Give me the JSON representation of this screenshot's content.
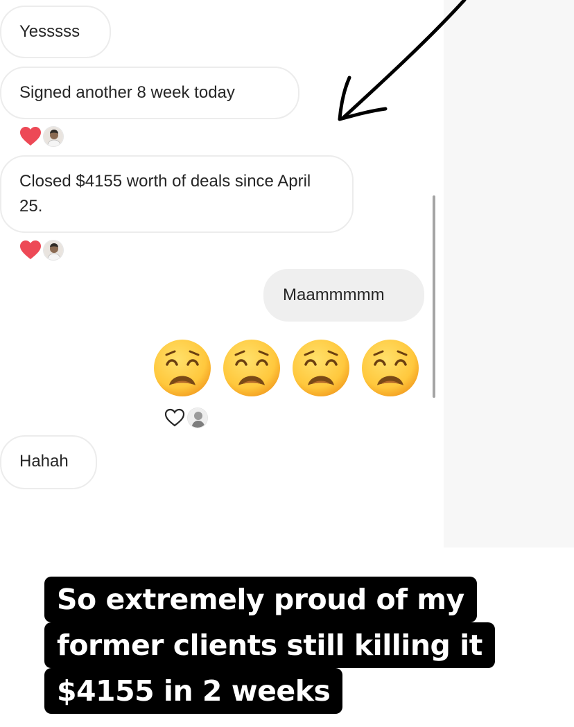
{
  "messages": [
    {
      "text": "Yesssss",
      "direction": "incoming"
    },
    {
      "text": "Signed another 8 week today",
      "direction": "incoming"
    },
    {
      "text": "Closed $4155 worth of deals since April 25.",
      "direction": "incoming"
    },
    {
      "text": "Maammmmm",
      "direction": "outgoing"
    },
    {
      "text": "Hahah",
      "direction": "incoming"
    }
  ],
  "emoji_message": {
    "emoji_name": "weary-face-emoji",
    "count": 4
  },
  "reactions": [
    {
      "icon": "heart-filled-icon",
      "color": "#ed4956"
    },
    {
      "icon": "heart-filled-icon",
      "color": "#ed4956"
    },
    {
      "icon": "heart-outline-icon",
      "color": "#262626"
    }
  ],
  "caption": {
    "line1": "So extremely proud of my",
    "line2": "former clients still killing it",
    "line3": "$4155 in 2 weeks"
  },
  "colors": {
    "incoming_bubble_border": "#ececec",
    "outgoing_bubble_bg": "#efefef",
    "text": "#262626",
    "caption_bg": "#000000",
    "caption_text": "#ffffff",
    "emoji_yellow": "#ffc83d"
  }
}
